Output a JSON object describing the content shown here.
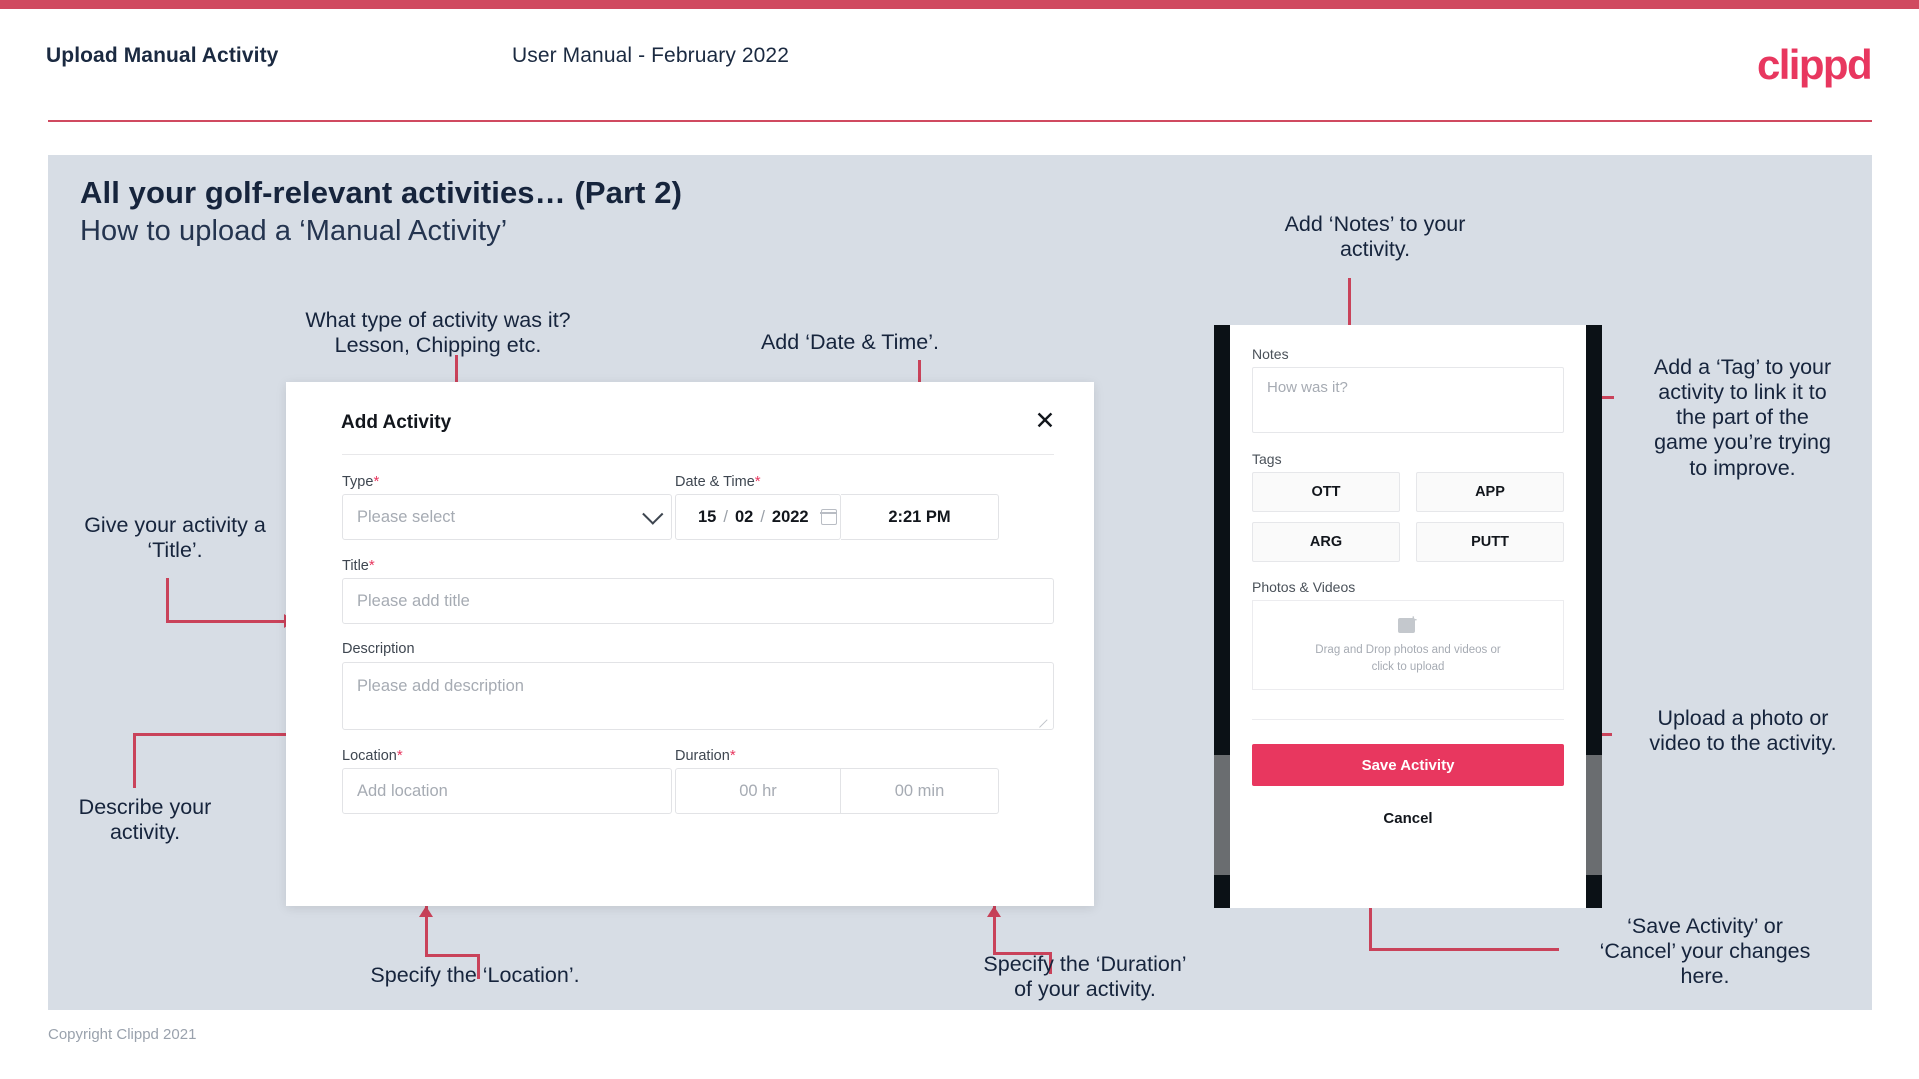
{
  "header": {
    "title": "Upload Manual Activity",
    "subtitle": "User Manual - February 2022",
    "logo": "clippd"
  },
  "slide": {
    "title": "All your golf-relevant activities… (Part 2)",
    "subtitle": "How to upload a ‘Manual Activity’",
    "copyright": "Copyright Clippd 2021"
  },
  "annotations": {
    "type": "What type of activity was it?\nLesson, Chipping etc.",
    "datetime": "Add ‘Date & Time’.",
    "notes": "Add ‘Notes’ to your\nactivity.",
    "tag": "Add a ‘Tag’ to your\nactivity to link it to\nthe part of the\ngame you’re trying\nto improve.",
    "title_field": "Give your activity a\n‘Title’.",
    "description_field": "Describe your\nactivity.",
    "location_field": "Specify the ‘Location’.",
    "duration_field": "Specify the ‘Duration’\nof your activity.",
    "upload": "Upload a photo or\nvideo to the activity.",
    "save_cancel": "‘Save Activity’ or\n‘Cancel’ your changes\nhere."
  },
  "dialog": {
    "title": "Add Activity",
    "close_icon": "close-icon",
    "fields": {
      "type": {
        "label": "Type",
        "required": "*",
        "placeholder": "Please select"
      },
      "datetime": {
        "label": "Date & Time",
        "required": "*",
        "day": "15",
        "month": "02",
        "year": "2022",
        "sep": "/",
        "time": "2:21 PM"
      },
      "title": {
        "label": "Title",
        "required": "*",
        "placeholder": "Please add title"
      },
      "description": {
        "label": "Description",
        "required": "",
        "placeholder": "Please add description"
      },
      "location": {
        "label": "Location",
        "required": "*",
        "placeholder": "Add location"
      },
      "duration": {
        "label": "Duration",
        "required": "*",
        "hours_placeholder": "00 hr",
        "minutes_placeholder": "00 min"
      }
    }
  },
  "phone": {
    "notes_label": "Notes",
    "notes_placeholder": "How was it?",
    "tags_label": "Tags",
    "tags": [
      "OTT",
      "APP",
      "ARG",
      "PUTT"
    ],
    "photos_label": "Photos & Videos",
    "drop_text": "Drag and Drop photos and videos or\nclick to upload",
    "drop_icon": "add-image-icon",
    "save_label": "Save Activity",
    "cancel_label": "Cancel"
  },
  "colors": {
    "accent": "#e8375f",
    "arrow": "#c9425a",
    "slide_bg": "#d7dde5",
    "top_bar": "#d04a60"
  }
}
